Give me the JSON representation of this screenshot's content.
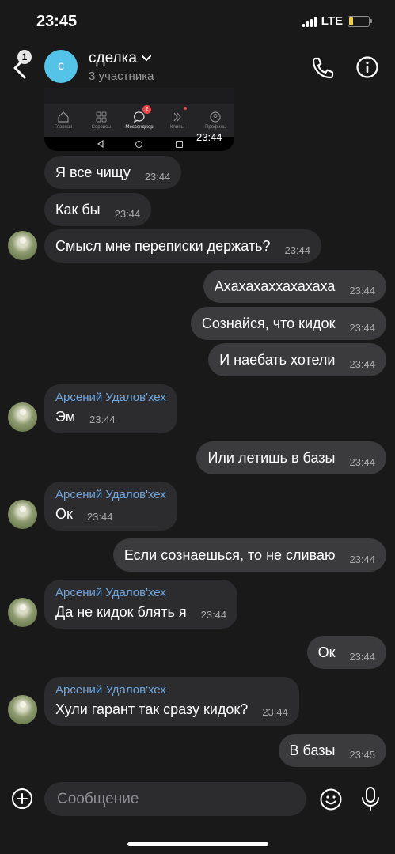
{
  "status_bar": {
    "time": "23:45",
    "network": "LTE"
  },
  "header": {
    "back_badge": "1",
    "avatar_letter": "с",
    "title": "сделка",
    "subtitle": "3 участника"
  },
  "attachment": {
    "nav_items": [
      {
        "label": "Главная",
        "icon": "home-icon"
      },
      {
        "label": "Сервисы",
        "icon": "services-icon"
      },
      {
        "label": "Мессенджер",
        "icon": "messenger-icon",
        "badge": "2",
        "active": true
      },
      {
        "label": "Клипы",
        "icon": "clips-icon"
      },
      {
        "label": "Профиль",
        "icon": "profile-icon"
      }
    ],
    "time": "23:44"
  },
  "messages": [
    {
      "text": "Я все чищу",
      "time": "23:44"
    },
    {
      "text": "Как бы",
      "time": "23:44"
    },
    {
      "text": "Смысл мне переписки держать?",
      "time": "23:44"
    },
    {
      "text": "Ахахахаххахахаха",
      "time": "23:44"
    },
    {
      "text": "Сознайся, что кидок",
      "time": "23:44"
    },
    {
      "text": "И наебать хотели",
      "time": "23:44"
    },
    {
      "sender": "Арсений Удалов'хех",
      "text": "Эм",
      "time": "23:44"
    },
    {
      "text": "Или летишь в базы",
      "time": "23:44"
    },
    {
      "sender": "Арсений Удалов'хех",
      "text": "Ок",
      "time": "23:44"
    },
    {
      "text": "Если сознаешься, то не сливаю",
      "time": "23:44"
    },
    {
      "sender": "Арсений Удалов'хех",
      "text": "Да не кидок блять я",
      "time": "23:44"
    },
    {
      "text": "Ок",
      "time": "23:44"
    },
    {
      "sender": "Арсений Удалов'хех",
      "text": "Хули гарант так сразу кидок?",
      "time": "23:44"
    },
    {
      "text": "В базы",
      "time": "23:45"
    }
  ],
  "composer": {
    "placeholder": "Сообщение"
  },
  "colors": {
    "background": "#19191a",
    "bubble_in": "#2c2c2e",
    "bubble_out": "#3b3b3d",
    "sender_name": "#6ea6e0",
    "avatar": "#55c3e8"
  }
}
